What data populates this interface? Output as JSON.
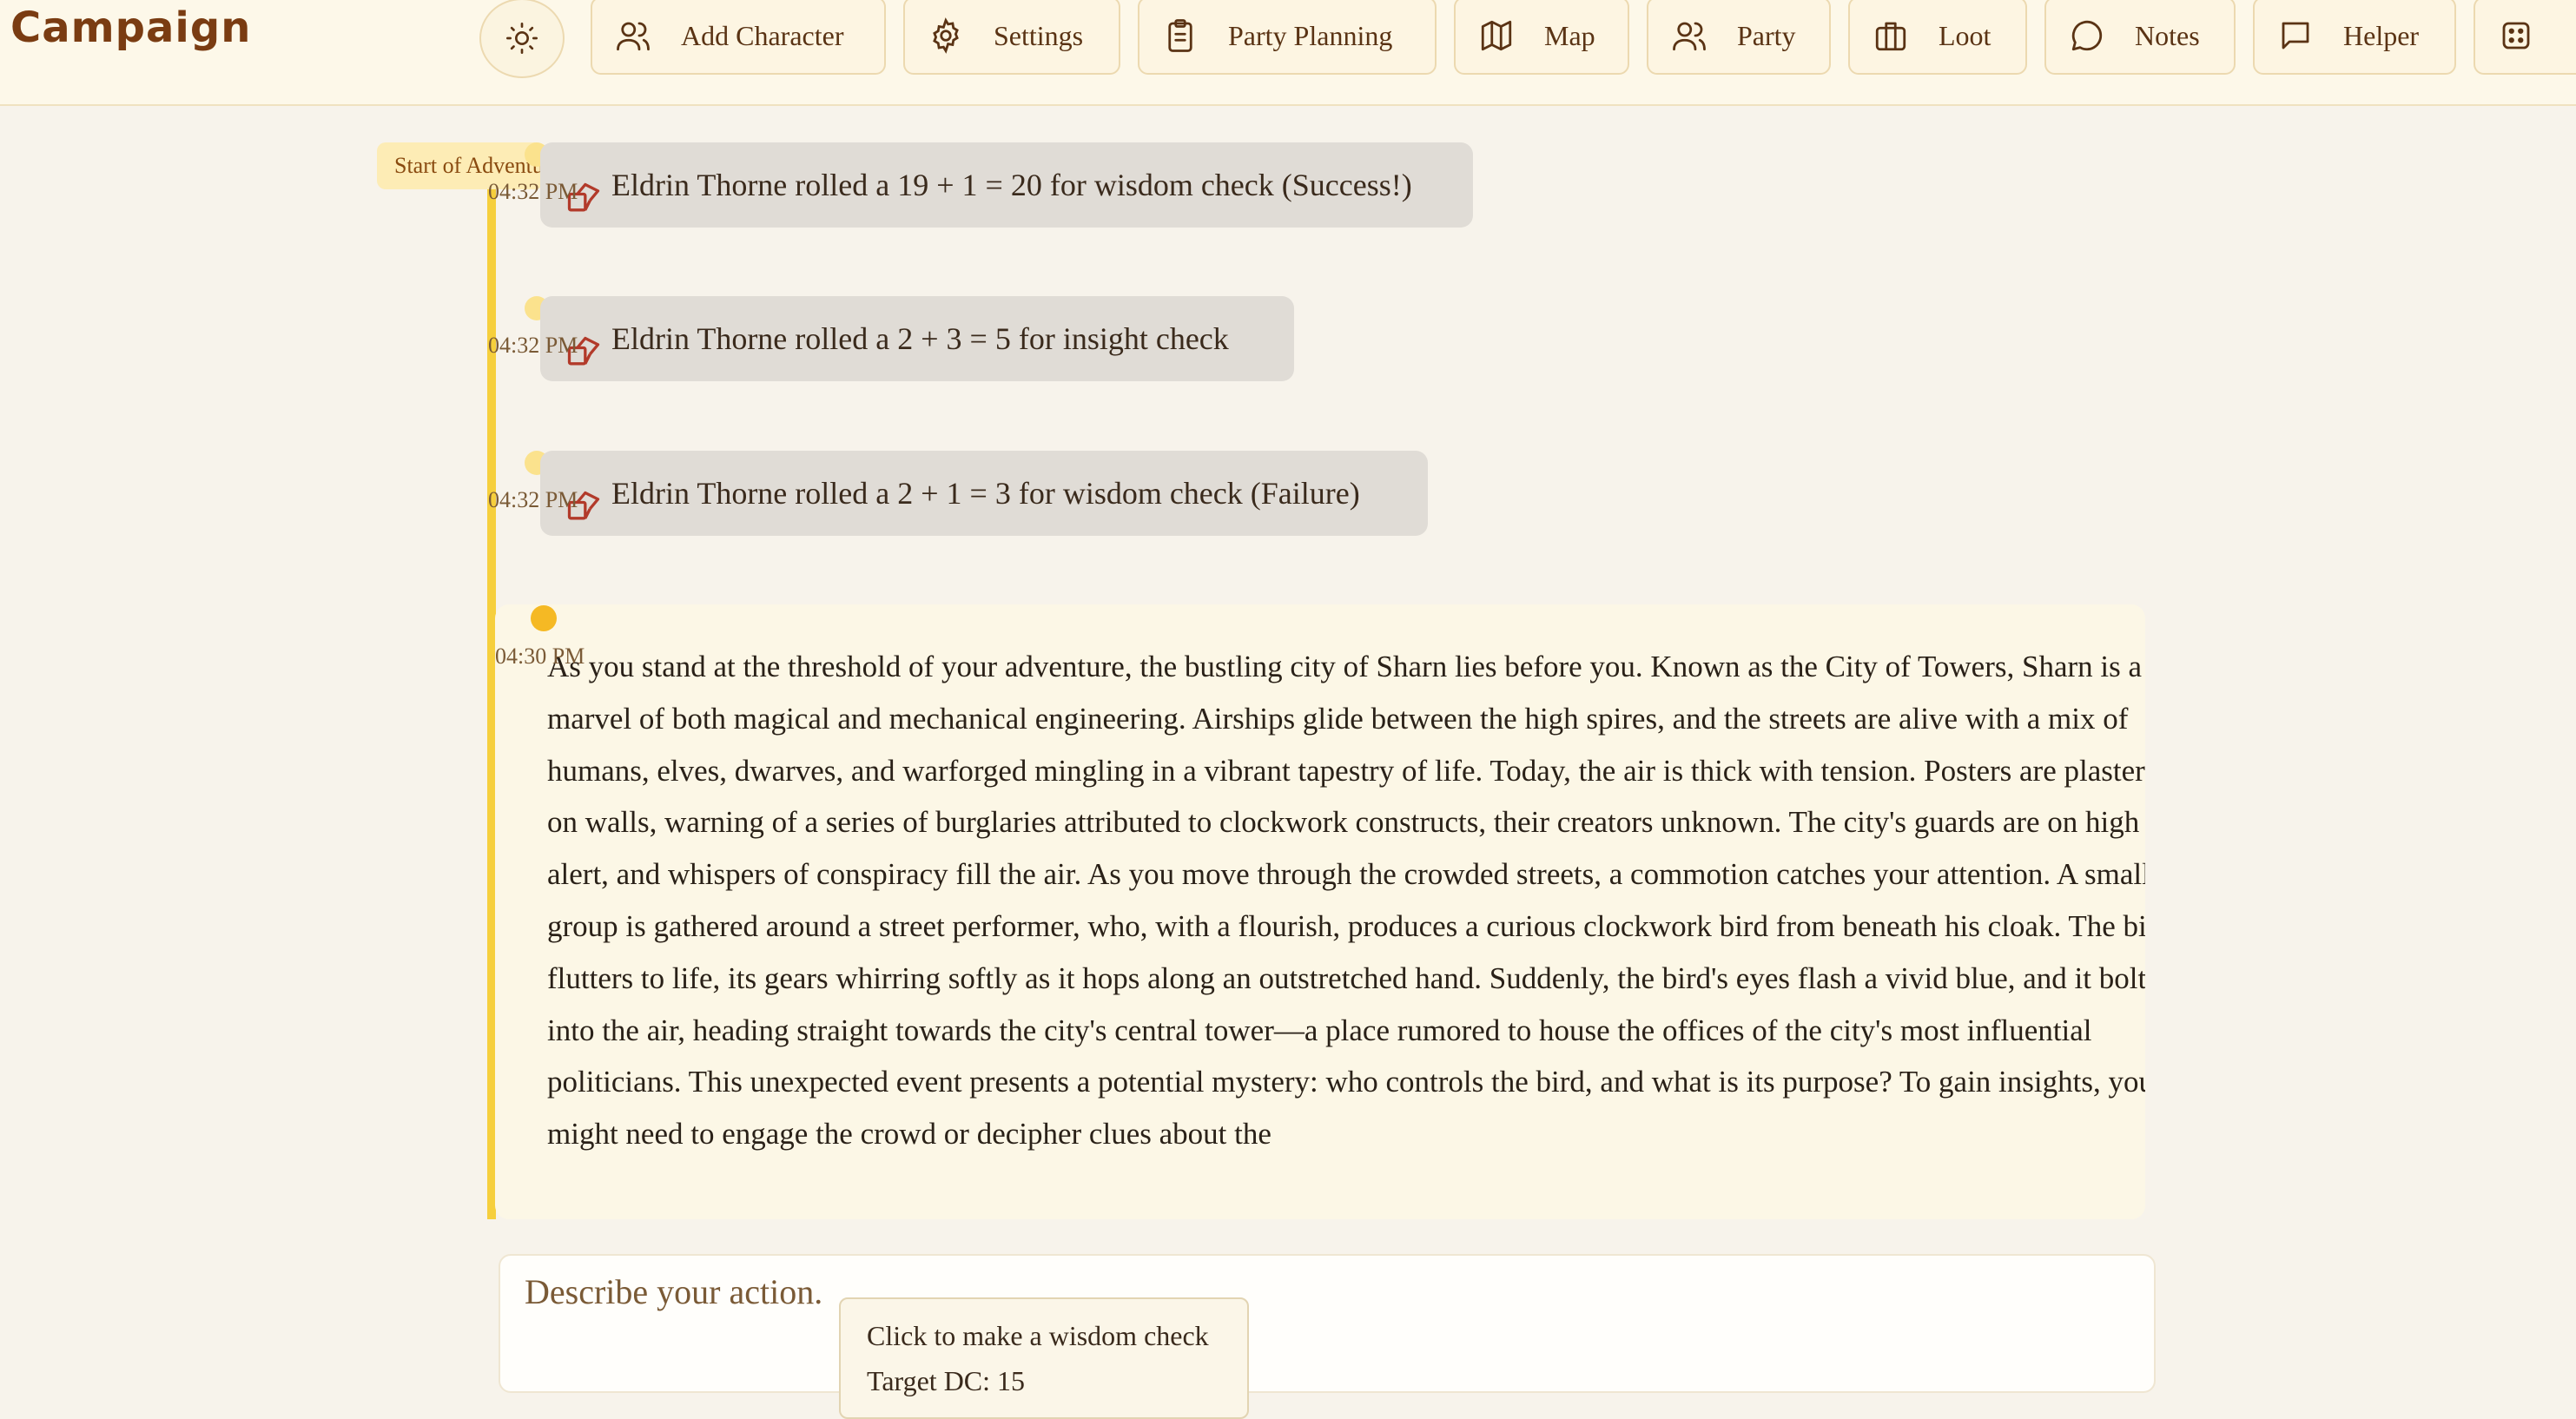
{
  "header": {
    "app_title": "Campaign",
    "theme_toggle_icon": "sun-icon",
    "nav": [
      {
        "label": "Add Character",
        "icon": "users-icon"
      },
      {
        "label": "Settings",
        "icon": "gear-icon"
      },
      {
        "label": "Party Planning",
        "icon": "clipboard-icon"
      },
      {
        "label": "Map",
        "icon": "map-icon"
      },
      {
        "label": "Party",
        "icon": "users-icon"
      },
      {
        "label": "Loot",
        "icon": "briefcase-icon"
      },
      {
        "label": "Notes",
        "icon": "chat-bubble-icon"
      },
      {
        "label": "Helper",
        "icon": "message-square-icon"
      },
      {
        "label": "",
        "icon": "dice-icon"
      }
    ]
  },
  "timeline": {
    "start_label": "Start of Adventure",
    "accent_color": "#f6cf3d",
    "rolls": [
      {
        "time": "04:32 PM",
        "text": "Eldrin Thorne rolled a 19 + 1 = 20 for wisdom check (Success!)"
      },
      {
        "time": "04:32 PM",
        "text": "Eldrin Thorne rolled a 2 + 3 = 5 for insight check"
      },
      {
        "time": "04:32 PM",
        "text": "Eldrin Thorne rolled a 2 + 1 = 3 for wisdom check (Failure)"
      }
    ],
    "narrative": {
      "time": "04:30 PM",
      "text": "As you stand at the threshold of your adventure, the bustling city of Sharn lies before you. Known as the City of Towers, Sharn is a marvel of both magical and mechanical engineering. Airships glide between the high spires, and the streets are alive with a mix of humans, elves, dwarves, and warforged mingling in a vibrant tapestry of life. Today, the air is thick with tension. Posters are plastered on walls, warning of a series of burglaries attributed to clockwork constructs, their creators unknown. The city's guards are on high alert, and whispers of conspiracy fill the air. As you move through the crowded streets, a commotion catches your attention. A small group is gathered around a street performer, who, with a flourish, produces a curious clockwork bird from beneath his cloak. The bird flutters to life, its gears whirring softly as it hops along an outstretched hand. Suddenly, the bird's eyes flash a vivid blue, and it bolts into the air, heading straight towards the city's central tower—a place rumored to house the offices of the city's most influential politicians. This unexpected event presents a potential mystery: who controls the bird, and what is its purpose? To gain insights, you might need to engage the crowd or decipher clues about the"
    }
  },
  "composer": {
    "placeholder": "Describe your action.",
    "tooltip_line1": "Click to make a wisdom check",
    "tooltip_line2": "Target DC: 15"
  }
}
